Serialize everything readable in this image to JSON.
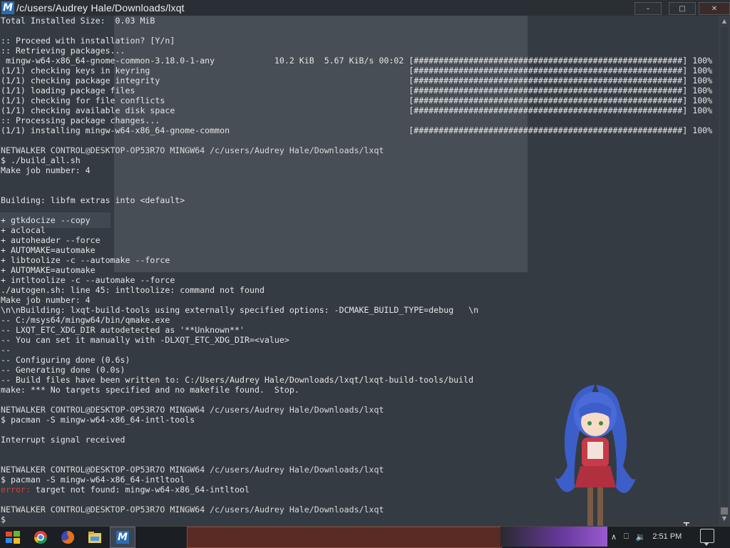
{
  "window": {
    "title": "/c/users/Audrey Hale/Downloads/lxqt",
    "app_icon_letter": "M",
    "controls": {
      "minimize": "–",
      "maximize": "□",
      "close": "✕"
    }
  },
  "terminal": {
    "lines": [
      {
        "text": "Total Installed Size:  0.03 MiB",
        "type": "out"
      },
      {
        "text": "",
        "type": "out"
      },
      {
        "text": ":: Proceed with installation? [Y/n]",
        "type": "out"
      },
      {
        "text": ":: Retrieving packages...",
        "type": "out"
      },
      {
        "text": " mingw-w64-x86_64-gnome-common-3.18.0-1-any            10.2 KiB  5.67 KiB/s 00:02 [######################################################] 100%",
        "type": "out"
      },
      {
        "text": "(1/1) checking keys in keyring                                                    [######################################################] 100%",
        "type": "out"
      },
      {
        "text": "(1/1) checking package integrity                                                  [######################################################] 100%",
        "type": "out"
      },
      {
        "text": "(1/1) loading package files                                                       [######################################################] 100%",
        "type": "out"
      },
      {
        "text": "(1/1) checking for file conflicts                                                 [######################################################] 100%",
        "type": "out"
      },
      {
        "text": "(1/1) checking available disk space                                               [######################################################] 100%",
        "type": "out"
      },
      {
        "text": ":: Processing package changes...",
        "type": "out"
      },
      {
        "text": "(1/1) installing mingw-w64-x86_64-gnome-common                                    [######################################################] 100%",
        "type": "out"
      },
      {
        "text": "",
        "type": "out"
      },
      {
        "text": "NETWALKER CONTROL@DESKTOP-OP53R7O MINGW64 /c/users/Audrey Hale/Downloads/lxqt",
        "type": "prompt"
      },
      {
        "text": "$ ./build_all.sh",
        "type": "out"
      },
      {
        "text": "Make job number: 4",
        "type": "out"
      },
      {
        "text": "",
        "type": "out"
      },
      {
        "text": "",
        "type": "out"
      },
      {
        "text": "Building: libfm extras into <default>",
        "type": "out"
      },
      {
        "text": "",
        "type": "out"
      },
      {
        "text": "+ gtkdocize --copy",
        "type": "out"
      },
      {
        "text": "+ aclocal",
        "type": "out"
      },
      {
        "text": "+ autoheader --force",
        "type": "out"
      },
      {
        "text": "+ AUTOMAKE=automake",
        "type": "out"
      },
      {
        "text": "+ libtoolize -c --automake --force",
        "type": "out"
      },
      {
        "text": "+ AUTOMAKE=automake",
        "type": "out"
      },
      {
        "text": "+ intltoolize -c --automake --force",
        "type": "out"
      },
      {
        "text": "./autogen.sh: line 45: intltoolize: command not found",
        "type": "out"
      },
      {
        "text": "Make job number: 4",
        "type": "out"
      },
      {
        "text": "\\n\\nBuilding: lxqt-build-tools using externally specified options: -DCMAKE_BUILD_TYPE=debug   \\n",
        "type": "out"
      },
      {
        "text": "-- C:/msys64/mingw64/bin/qmake.exe",
        "type": "out"
      },
      {
        "text": "-- LXQT_ETC_XDG_DIR autodetected as '**Unknown**'",
        "type": "out"
      },
      {
        "text": "-- You can set it manually with -DLXQT_ETC_XDG_DIR=<value>",
        "type": "out"
      },
      {
        "text": "--",
        "type": "out"
      },
      {
        "text": "-- Configuring done (0.6s)",
        "type": "out"
      },
      {
        "text": "-- Generating done (0.0s)",
        "type": "out"
      },
      {
        "text": "-- Build files have been written to: C:/Users/Audrey Hale/Downloads/lxqt/lxqt-build-tools/build",
        "type": "out"
      },
      {
        "text": "make: *** No targets specified and no makefile found.  Stop.",
        "type": "out"
      },
      {
        "text": "",
        "type": "out"
      },
      {
        "text": "NETWALKER CONTROL@DESKTOP-OP53R7O MINGW64 /c/users/Audrey Hale/Downloads/lxqt",
        "type": "prompt"
      },
      {
        "text": "$ pacman -S mingw-w64-x86_64-intl-tools",
        "type": "out"
      },
      {
        "text": "",
        "type": "out"
      },
      {
        "text": "Interrupt signal received",
        "type": "out"
      },
      {
        "text": "",
        "type": "out"
      },
      {
        "text": "",
        "type": "out"
      },
      {
        "text": "NETWALKER CONTROL@DESKTOP-OP53R7O MINGW64 /c/users/Audrey Hale/Downloads/lxqt",
        "type": "prompt"
      },
      {
        "text": "$ pacman -S mingw-w64-x86_64-intltool",
        "type": "out"
      },
      {
        "text": "error: target not found: mingw-w64-x86_64-intltool",
        "type": "error",
        "prefix": "error:",
        "rest": " target not found: mingw-w64-x86_64-intltool"
      },
      {
        "text": "",
        "type": "out"
      },
      {
        "text": "NETWALKER CONTROL@DESKTOP-OP53R7O MINGW64 /c/users/Audrey Hale/Downloads/lxqt",
        "type": "prompt"
      },
      {
        "text": "$",
        "type": "out"
      }
    ]
  },
  "taskbar": {
    "start_icon": "windows-flag-icon",
    "apps": [
      {
        "name": "chrome-icon",
        "glyph": "◉",
        "color": "#e0a020"
      },
      {
        "name": "firefox-icon",
        "glyph": "●",
        "color": "#e07020"
      },
      {
        "name": "file-explorer-icon",
        "glyph": "▭",
        "color": "#e8c860"
      },
      {
        "name": "msys2-icon",
        "glyph": "M",
        "color": "#ffffff"
      }
    ],
    "tray": {
      "chevron": "∧",
      "network": "⎕",
      "volume": "🔉",
      "clock": "2:51 PM"
    }
  },
  "colors": {
    "terminal_bg": "#343b42",
    "text": "#e6e6e6",
    "error": "#d04040",
    "titlebar": "#2a2f35"
  }
}
